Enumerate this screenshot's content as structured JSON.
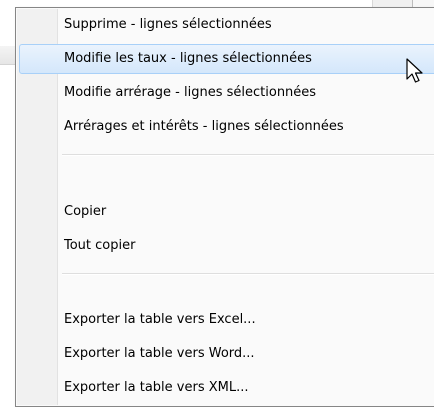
{
  "menu": {
    "items": [
      {
        "id": "supprime",
        "label": "Supprime - lignes sélectionnées",
        "highlighted": false
      },
      {
        "id": "modifie-taux",
        "label": "Modifie les taux - lignes sélectionnées",
        "highlighted": true
      },
      {
        "id": "modifie-arrerage",
        "label": "Modifie arrérage - lignes sélectionnées",
        "highlighted": false
      },
      {
        "id": "arrerages-interets",
        "label": "Arrérages et intérêts - lignes sélectionnées",
        "highlighted": false
      },
      {
        "id": "copier",
        "label": "Copier",
        "highlighted": false
      },
      {
        "id": "tout-copier",
        "label": "Tout copier",
        "highlighted": false
      },
      {
        "id": "export-excel",
        "label": "Exporter la table vers Excel...",
        "highlighted": false
      },
      {
        "id": "export-word",
        "label": "Exporter la table vers Word...",
        "highlighted": false
      },
      {
        "id": "export-xml",
        "label": "Exporter la table vers XML...",
        "highlighted": false
      }
    ]
  },
  "cursor": {
    "icon": "mouse-pointer-icon"
  },
  "colors": {
    "highlight_bg": "#d4e7fb",
    "highlight_border": "#a8d0f8",
    "menu_border": "#868686"
  }
}
